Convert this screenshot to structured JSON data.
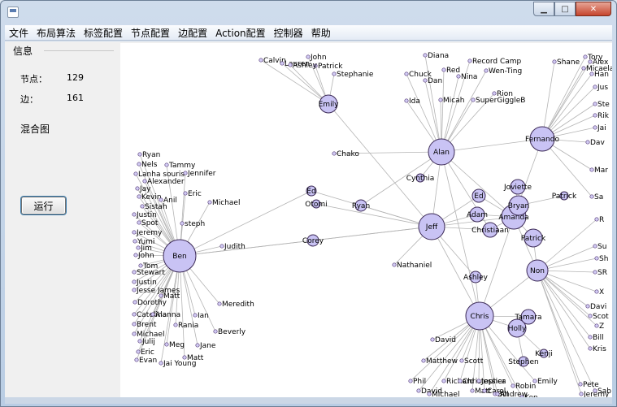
{
  "window": {
    "minimize_label": "▁",
    "maximize_label": "□",
    "close_label": "✕"
  },
  "menu": [
    "文件",
    "布局算法",
    "标签配置",
    "节点配置",
    "边配置",
    "Action配置",
    "控制器",
    "帮助"
  ],
  "info": {
    "title": "信息",
    "nodes_label": "节点：",
    "nodes_value": "129",
    "edges_label": "边：",
    "edges_value": "161",
    "graph_type": "混合图",
    "run_label": "运行"
  },
  "graph": {
    "hubs": [
      {
        "id": "Ben",
        "label": "Ben",
        "size": 20
      },
      {
        "id": "Jeff",
        "label": "Jeff",
        "size": 16
      },
      {
        "id": "Alan",
        "label": "Alan",
        "size": 16
      },
      {
        "id": "Chris",
        "label": "Chris",
        "size": 17
      },
      {
        "id": "Fernando",
        "label": "Fernando",
        "size": 15
      },
      {
        "id": "Non",
        "label": "Non",
        "size": 13
      },
      {
        "id": "Amanda",
        "label": "Amanda",
        "size": 15
      },
      {
        "id": "Emily",
        "label": "Emily",
        "size": 11
      },
      {
        "id": "Bryan",
        "label": "Bryan",
        "size": 12
      },
      {
        "id": "Patrick2",
        "label": "Patrick",
        "size": 11
      },
      {
        "id": "Holly",
        "label": "Holly",
        "size": 11
      },
      {
        "id": "Tamara",
        "label": "Tamara",
        "size": 9
      },
      {
        "id": "Joviette",
        "label": "Joviette",
        "size": 9
      },
      {
        "id": "Christiaan",
        "label": "Christiaan",
        "size": 9
      },
      {
        "id": "Adam",
        "label": "Adam",
        "size": 9
      },
      {
        "id": "Ed2",
        "label": "Ed",
        "size": 8
      },
      {
        "id": "Ashley",
        "label": "Ashley",
        "size": 7
      },
      {
        "id": "Corey",
        "label": "Corey",
        "size": 7
      },
      {
        "id": "Ryan",
        "label": "Ryan",
        "size": 7
      },
      {
        "id": "Ed",
        "label": "Ed",
        "size": 6
      },
      {
        "id": "Otomi",
        "label": "Otomi",
        "size": 5
      },
      {
        "id": "Cynthia",
        "label": "Cynthia",
        "size": 5
      },
      {
        "id": "Stephen",
        "label": "Stephen",
        "size": 6
      },
      {
        "id": "Kenji",
        "label": "Kenji",
        "size": 5
      },
      {
        "id": "Patrick3",
        "label": "Patrick",
        "size": 5
      }
    ],
    "leaves": [
      {
        "label": "Calvin",
        "hub": "Emily"
      },
      {
        "label": "John",
        "hub": "Emily"
      },
      {
        "label": "Lauren",
        "hub": "Emily"
      },
      {
        "label": "Patrick",
        "hub": "Emily"
      },
      {
        "label": "Stephanie",
        "hub": "Emily"
      },
      {
        "label": "Ashley",
        "hub": "Emily"
      },
      {
        "label": "Diana",
        "hub": "Alan"
      },
      {
        "label": "Record Camp",
        "hub": "Alan"
      },
      {
        "label": "Red",
        "hub": "Alan"
      },
      {
        "label": "Nina",
        "hub": "Alan"
      },
      {
        "label": "Wen-Ting",
        "hub": "Alan"
      },
      {
        "label": "Chuck",
        "hub": "Alan"
      },
      {
        "label": "Dan",
        "hub": "Alan"
      },
      {
        "label": "Rion",
        "hub": "Alan"
      },
      {
        "label": "Ida",
        "hub": "Alan"
      },
      {
        "label": "Micah",
        "hub": "Alan"
      },
      {
        "label": "SuperGiggleB",
        "hub": "Alan"
      },
      {
        "label": "Chako",
        "hub": "Alan"
      },
      {
        "label": "Shane",
        "hub": "Fernando"
      },
      {
        "label": "Tory",
        "hub": "Fernando"
      },
      {
        "label": "Alex",
        "hub": "Fernando"
      },
      {
        "label": "Micaela",
        "hub": "Fernando"
      },
      {
        "label": "Han",
        "hub": "Fernando"
      },
      {
        "label": "Jus",
        "hub": "Fernando"
      },
      {
        "label": "Ste",
        "hub": "Fernando"
      },
      {
        "label": "Rik",
        "hub": "Fernando"
      },
      {
        "label": "Jai",
        "hub": "Fernando"
      },
      {
        "label": "Dav",
        "hub": "Fernando"
      },
      {
        "label": "Mar",
        "hub": "Fernando"
      },
      {
        "label": "Sa",
        "hub": "Fernando"
      },
      {
        "label": "Ryan",
        "hub": "Ben"
      },
      {
        "label": "Nels",
        "hub": "Ben"
      },
      {
        "label": "Tammy",
        "hub": "Ben"
      },
      {
        "label": "Lanha souris",
        "hub": "Ben"
      },
      {
        "label": "Jennifer",
        "hub": "Ben"
      },
      {
        "label": "Alexander",
        "hub": "Ben"
      },
      {
        "label": "Jay",
        "hub": "Ben"
      },
      {
        "label": "Eric",
        "hub": "Ben"
      },
      {
        "label": "Kevin",
        "hub": "Ben"
      },
      {
        "label": "Anil",
        "hub": "Ben"
      },
      {
        "label": "Michael",
        "hub": "Ben"
      },
      {
        "label": "Sistah",
        "hub": "Ben"
      },
      {
        "label": "Justin",
        "hub": "Ben"
      },
      {
        "label": "Spot",
        "hub": "Ben"
      },
      {
        "label": "steph",
        "hub": "Ben"
      },
      {
        "label": "Jeremy",
        "hub": "Ben"
      },
      {
        "label": "Yumi",
        "hub": "Ben"
      },
      {
        "label": "Jim",
        "hub": "Ben"
      },
      {
        "label": "Judith",
        "hub": "Ben"
      },
      {
        "label": "John",
        "hub": "Ben"
      },
      {
        "label": "Tom",
        "hub": "Ben"
      },
      {
        "label": "Stewart",
        "hub": "Ben"
      },
      {
        "label": "Justin",
        "hub": "Ben"
      },
      {
        "label": "Jesse James",
        "hub": "Ben"
      },
      {
        "label": "Matt",
        "hub": "Ben"
      },
      {
        "label": "Dorothy",
        "hub": "Ben"
      },
      {
        "label": "Meredith",
        "hub": "Ben"
      },
      {
        "label": "Catelina",
        "hub": "Ben"
      },
      {
        "label": "Alanna",
        "hub": "Ben"
      },
      {
        "label": "Ian",
        "hub": "Ben"
      },
      {
        "label": "Brent",
        "hub": "Ben"
      },
      {
        "label": "Rania",
        "hub": "Ben"
      },
      {
        "label": "Michael",
        "hub": "Ben"
      },
      {
        "label": "Beverly",
        "hub": "Ben"
      },
      {
        "label": "Julij",
        "hub": "Ben"
      },
      {
        "label": "Meg",
        "hub": "Ben"
      },
      {
        "label": "Jane",
        "hub": "Ben"
      },
      {
        "label": "Eric",
        "hub": "Ben"
      },
      {
        "label": "Evan",
        "hub": "Ben"
      },
      {
        "label": "Matt",
        "hub": "Ben"
      },
      {
        "label": "Jai Young",
        "hub": "Ben"
      },
      {
        "label": "Nathaniel",
        "hub": "Jeff"
      },
      {
        "label": "David",
        "hub": "Chris"
      },
      {
        "label": "Matthew",
        "hub": "Chris"
      },
      {
        "label": "Scott",
        "hub": "Chris"
      },
      {
        "label": "Phil",
        "hub": "Chris"
      },
      {
        "label": "Richard",
        "hub": "Chris"
      },
      {
        "label": "Christopher",
        "hub": "Chris"
      },
      {
        "label": "Jessica",
        "hub": "Chris"
      },
      {
        "label": "David",
        "hub": "Chris"
      },
      {
        "label": "Matt",
        "hub": "Chris"
      },
      {
        "label": "Michael",
        "hub": "Chris"
      },
      {
        "label": "Carol",
        "hub": "Chris"
      },
      {
        "label": "Bill",
        "hub": "Chris"
      },
      {
        "label": "Robin",
        "hub": "Chris"
      },
      {
        "label": "Andrew",
        "hub": "Chris"
      },
      {
        "label": "Ken",
        "hub": "Chris"
      },
      {
        "label": "Emily",
        "hub": "Chris"
      },
      {
        "label": "Pete",
        "hub": "Non"
      },
      {
        "label": "Jeremy",
        "hub": "Non"
      },
      {
        "label": "Sab",
        "hub": "Non"
      },
      {
        "label": "Davi",
        "hub": "Non"
      },
      {
        "label": "Scot",
        "hub": "Non"
      },
      {
        "label": "Z",
        "hub": "Non"
      },
      {
        "label": "Bill",
        "hub": "Non"
      },
      {
        "label": "Kris",
        "hub": "Non"
      },
      {
        "label": "Su",
        "hub": "Non"
      },
      {
        "label": "SR",
        "hub": "Non"
      },
      {
        "label": "X",
        "hub": "Non"
      },
      {
        "label": "R",
        "hub": "Non"
      },
      {
        "label": "Sh",
        "hub": "Non"
      }
    ]
  }
}
